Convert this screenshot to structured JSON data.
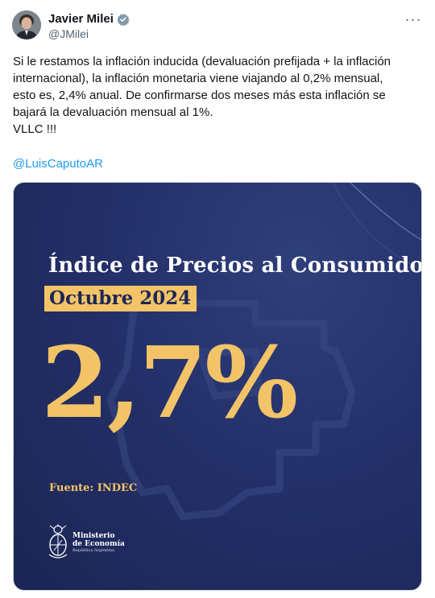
{
  "author": {
    "name": "Javier Milei",
    "handle": "@JMilei",
    "verified_icon": "verified-badge-icon"
  },
  "menu": {
    "more_icon": "more-dots-icon",
    "more_label": "···"
  },
  "tweet": {
    "lines": [
      "Si le restamos la inflación inducida (devaluación prefijada + la inflación",
      "internacional), la inflación monetaria viene viajando al 0,2% mensual,",
      "esto es, 2,4% anual. De confirmarse dos meses más esta inflación se",
      "bajará la devaluación mensual al 1%.",
      "VLLC !!!"
    ],
    "mention": "@LuisCaputoAR"
  },
  "card": {
    "title": "Índice de Precios al Consumidor",
    "date": "Octubre 2024",
    "value": "2,7%",
    "source": "Fuente: INDEC",
    "ministry_line1": "Ministerio",
    "ministry_line2": "de Economía",
    "ministry_sub": "República Argentina"
  },
  "colors": {
    "card_background": "#24306a",
    "highlight_gold": "#f3c467",
    "link_blue": "#1d9bf0",
    "verified_blue": "#829aab"
  }
}
